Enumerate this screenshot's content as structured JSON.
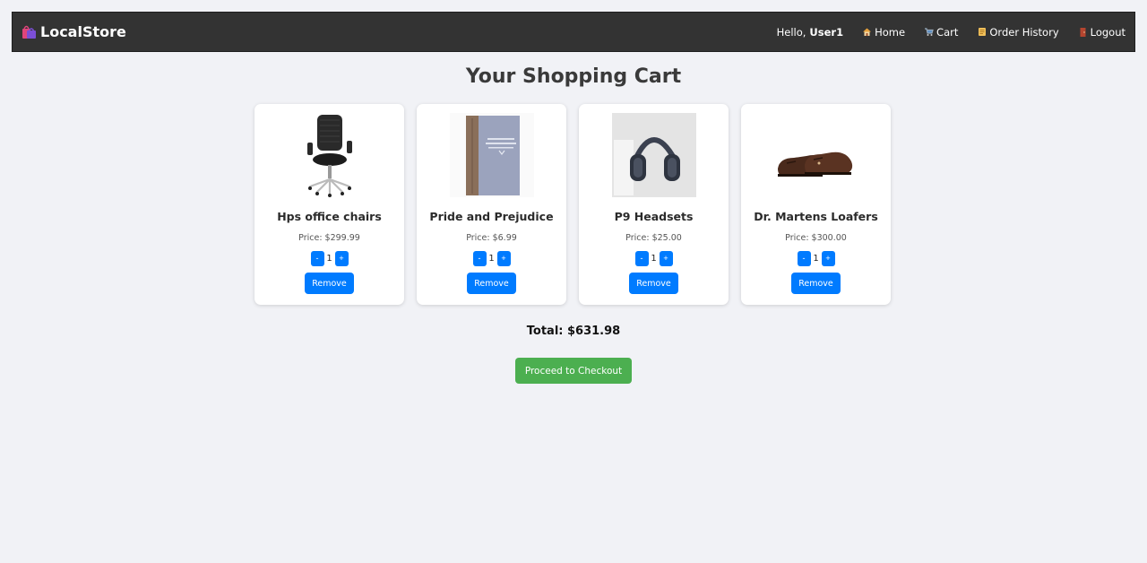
{
  "nav": {
    "brand": "LocalStore",
    "greeting_prefix": "Hello,",
    "username": "User1",
    "links": [
      {
        "label": "Home",
        "icon": "home-icon"
      },
      {
        "label": "Cart",
        "icon": "cart-icon"
      },
      {
        "label": "Order History",
        "icon": "scroll-icon"
      },
      {
        "label": "Logout",
        "icon": "door-icon"
      }
    ]
  },
  "page": {
    "title": "Your Shopping Cart"
  },
  "cart": {
    "items": [
      {
        "name": "Hps office chairs",
        "price": "Price: $299.99",
        "qty": "1",
        "remove": "Remove",
        "minus": "-",
        "plus": "+",
        "image": "office-chair-image"
      },
      {
        "name": "Pride and Prejudice",
        "price": "Price: $6.99",
        "qty": "1",
        "remove": "Remove",
        "minus": "-",
        "plus": "+",
        "image": "book-image"
      },
      {
        "name": "P9 Headsets",
        "price": "Price: $25.00",
        "qty": "1",
        "remove": "Remove",
        "minus": "-",
        "plus": "+",
        "image": "headphones-image"
      },
      {
        "name": "Dr. Martens Loafers",
        "price": "Price: $300.00",
        "qty": "1",
        "remove": "Remove",
        "minus": "-",
        "plus": "+",
        "image": "loafers-image"
      }
    ],
    "total": "Total: $631.98",
    "checkout_label": "Proceed to Checkout"
  },
  "colors": {
    "navbar": "#333333",
    "primary": "#007bff",
    "checkout": "#4caf50",
    "background": "#f1f2f6"
  }
}
